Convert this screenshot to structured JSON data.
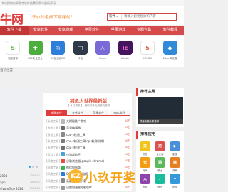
{
  "topbar": {
    "text": "本站提供安卓游戏软件免费下载与更新资讯"
  },
  "header": {
    "logo": "牛网",
    "slogan": "开心的免费下载网站！",
    "search_type": "软件",
    "search_placeholder": "请输入您要搜索的内容"
  },
  "nav": {
    "items": [
      {
        "label": "软件下载",
        "active": true
      },
      {
        "label": "安卓软件"
      },
      {
        "label": "安卓游戏"
      },
      {
        "label": "苹果软件"
      },
      {
        "label": "苹果游戏"
      },
      {
        "label": "专题合集"
      },
      {
        "label": "软件教程"
      }
    ]
  },
  "apps": [
    {
      "label": "电脑管家",
      "icon": "S",
      "color": "#ffffff",
      "fg": "#6bb840"
    },
    {
      "label": "360安全卫士",
      "icon": "✚",
      "color": "#4cae3d",
      "fg": "#ffffff"
    },
    {
      "label": "CC加速器PC",
      "icon": "◎",
      "color": "#2d7ed8",
      "fg": "#ffffff"
    },
    {
      "label": "抖音",
      "icon": "□",
      "color": "#2e3a48",
      "fg": "#ffffff"
    },
    {
      "label": "Hcore",
      "icon": "△",
      "color": "#7a6ad8",
      "fg": "#ffffff"
    },
    {
      "label": "Adobe",
      "icon": "Ic",
      "color": "#44155f",
      "fg": "#ff6ad0"
    },
    {
      "label": "HTML5",
      "icon": "5",
      "color": "#ffffff",
      "fg": "#e4552d"
    },
    {
      "label": "Edge浏览器",
      "icon": "◆",
      "color": "#2f8ad8",
      "fg": "#ffffff"
    }
  ],
  "crumb": "当前位置",
  "panel": {
    "title": "捕鱼大世界最新版",
    "subtitle": "【 今日更新 】 最新软件应用游戏推荐",
    "tabs": [
      {
        "label": "电脑软件",
        "active": true
      },
      {
        "label": "安卓软件"
      },
      {
        "label": "苹果软件"
      },
      {
        "label": "MAC软件"
      }
    ],
    "rows": [
      {
        "cat": "[系统工具]",
        "title": "大揭秘推广游戏",
        "date": "10日",
        "color": "#b9b9b9"
      },
      {
        "cat": "[系统工具]",
        "title": "音频编辑器",
        "date": "10日",
        "color": "#6a6a6a"
      },
      {
        "cat": "[系统工具]",
        "title": "cpu-z检测工具",
        "date": "10日",
        "color": "#8a8a8a"
      },
      {
        "cat": "[系统工具]",
        "title": "cpu-z检测工具(cpu检测软件)",
        "date": "10日",
        "color": "#7c7c7c"
      },
      {
        "cat": "[系统工具]",
        "title": "cpu-z检测工具",
        "date": "10日",
        "color": "#707070"
      },
      {
        "cat": "[游戏工具]",
        "title": "小游戏助手",
        "date": "10日",
        "color": "#4aa2d8"
      },
      {
        "cat": "[网络工具]",
        "title": "谷歌浏览器(google chrome)",
        "date": "10日",
        "color": "#e84c3d"
      },
      {
        "cat": "[网络工具]",
        "title": "微信电脑版",
        "date": "10日",
        "color": "#3dae52"
      },
      {
        "cat": "[网络工具]",
        "title": "QQ浏览器电脑版",
        "date": "10日",
        "color": "#2d7ed8"
      },
      {
        "cat": "[网络工具]",
        "title": "高级浏览器下载",
        "date": "10日",
        "color": "#888888"
      },
      {
        "cat": "[网络工具]",
        "title": "迅雷加速器电脑版PC",
        "date": "10日",
        "color": "#9a9a9a"
      }
    ]
  },
  "left_list": [
    {
      "title": "2024",
      "date": "2024-01"
    },
    {
      "title": "app",
      "date": "2024-01"
    },
    {
      "title": "vivo-office 2024",
      "date": "2024-01"
    },
    {
      "title": "...",
      "date": "2024-01"
    }
  ],
  "side": {
    "topic_head": "推荐主题",
    "topic_caption": "精选专题合集推荐",
    "rec_head": "推荐应用",
    "rec_items": [
      {
        "label": "花花",
        "icon": "美",
        "color": "#f0c419"
      },
      {
        "label": "龙之谷",
        "icon": "龙",
        "color": "#d9534f"
      },
      {
        "label": "影视",
        "icon": "▶",
        "color": "#4a90d9"
      },
      {
        "label": "元气",
        "icon": "元",
        "color": "#f39c12"
      },
      {
        "label": "骑士",
        "icon": "骑",
        "color": "#5cb85c"
      },
      {
        "label": "商城",
        "icon": "商",
        "color": "#e67e22"
      },
      {
        "label": "大叔",
        "icon": "大",
        "color": "#8e44ad"
      },
      {
        "label": "音乐",
        "icon": "♪",
        "color": "#1abc9c"
      },
      {
        "label": "地图",
        "icon": "⌖",
        "color": "#3498db"
      }
    ]
  },
  "watermark": {
    "badge": "KZ",
    "text": "小玖开奖"
  }
}
